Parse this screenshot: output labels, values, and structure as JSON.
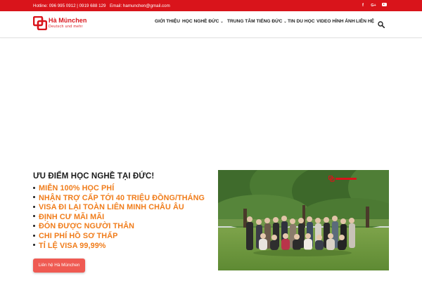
{
  "topbar": {
    "hotline": "Hotline: 096 995 0912 | 0919 688 129",
    "email": "Email: hamunchen@gmail.com",
    "social": [
      "facebook-icon",
      "google-plus-icon",
      "youtube-icon"
    ],
    "facebook_glyph": "f",
    "googleplus_glyph": "G+"
  },
  "brand": {
    "name": "Hà München",
    "tagline": "Deutsch und mehr"
  },
  "nav": {
    "items": [
      {
        "label": "GIỚI THIỆU",
        "has_dropdown": false
      },
      {
        "label": "HỌC NGHỀ ĐỨC",
        "has_dropdown": true
      },
      {
        "label": "TRUNG TÂM TIẾNG ĐỨC",
        "has_dropdown": true
      },
      {
        "label": "TIN DU HỌC",
        "has_dropdown": false
      },
      {
        "label": "VIDEO HÌNH ẢNH",
        "has_dropdown": false
      },
      {
        "label": "LIÊN HỆ",
        "has_dropdown": false
      }
    ],
    "caret": "⌄"
  },
  "advantages": {
    "title": "ƯU ĐIỂM HỌC NGHỀ TẠI ĐỨC!",
    "items": [
      "MIỄN 100% HỌC PHÍ",
      "NHẬN TRỢ CẤP TỚI 40 TRIỆU ĐỒNG/THÁNG",
      "VISA ĐI LẠI TOÀN LIÊN MINH CHÂU ÂU",
      "ĐỊNH CƯ MÃI MÃI",
      "ĐÓN ĐƯỢC NGƯỜI THÂN",
      "CHI PHÍ HỒ SƠ THẤP",
      "TỈ LỆ VISA 99,99%"
    ],
    "button_label": "Liên hệ Hà München"
  },
  "colors": {
    "brand_red": "#d9141b",
    "accent_orange": "#f07c1a",
    "button_coral": "#ef5a52",
    "text_dark": "#1a1a1a"
  }
}
